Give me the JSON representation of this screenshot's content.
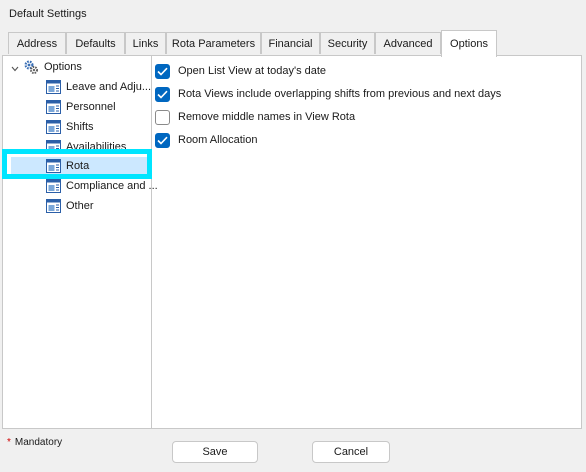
{
  "window": {
    "title": "Default Settings"
  },
  "tabs": [
    {
      "label": "Address",
      "active": false
    },
    {
      "label": "Defaults",
      "active": false
    },
    {
      "label": "Links",
      "active": false
    },
    {
      "label": "Rota Parameters",
      "active": false
    },
    {
      "label": "Financial",
      "active": false
    },
    {
      "label": "Security",
      "active": false
    },
    {
      "label": "Advanced",
      "active": false
    },
    {
      "label": "Options",
      "active": true
    }
  ],
  "tree": {
    "root": {
      "label": "Options",
      "expanded": true,
      "icon": "gear-icon"
    },
    "items": [
      {
        "label": "Leave and Adju...",
        "icon": "settings-page-icon"
      },
      {
        "label": "Personnel",
        "icon": "settings-page-icon"
      },
      {
        "label": "Shifts",
        "icon": "settings-page-icon"
      },
      {
        "label": "Availabilities",
        "icon": "settings-page-icon"
      },
      {
        "label": "Rota",
        "icon": "settings-page-icon",
        "selected": true
      },
      {
        "label": "Compliance and ...",
        "icon": "settings-page-icon"
      },
      {
        "label": "Other",
        "icon": "settings-page-icon"
      }
    ]
  },
  "options": [
    {
      "label": "Open List View at today's date",
      "checked": true
    },
    {
      "label": "Rota Views include overlapping shifts from previous and next days",
      "checked": true
    },
    {
      "label": "Remove middle names in View Rota",
      "checked": false
    },
    {
      "label": "Room Allocation",
      "checked": true
    }
  ],
  "footer": {
    "mandatory_marker": "*",
    "mandatory_label": "Mandatory",
    "save_label": "Save",
    "cancel_label": "Cancel"
  },
  "colors": {
    "accent": "#0067c0",
    "selection": "#cce8ff",
    "highlight_outline": "#00e5ff",
    "required_marker": "#d00000"
  }
}
